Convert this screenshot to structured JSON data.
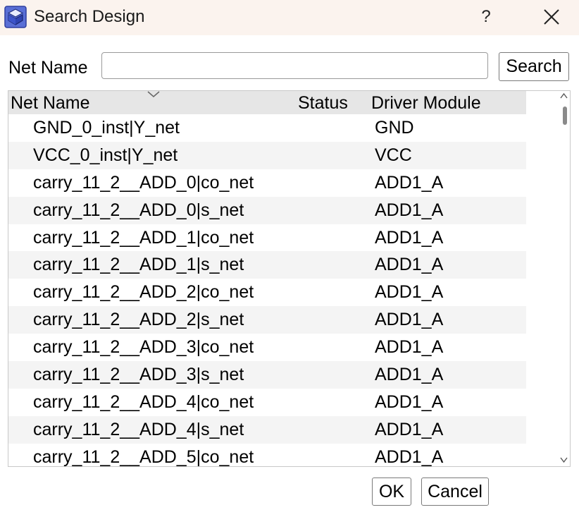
{
  "window": {
    "title": "Search Design",
    "help_label": "?",
    "icons": {
      "app": "app-logo-icon",
      "close": "close-icon"
    }
  },
  "search": {
    "label": "Net Name",
    "value": "",
    "placeholder": "",
    "button_label": "Search"
  },
  "table": {
    "columns": [
      "Net Name",
      "Status",
      "Driver Module"
    ],
    "sort_icon": "chevron-down-icon",
    "rows": [
      {
        "net_name": "GND_0_inst|Y_net",
        "status": "",
        "driver": "GND"
      },
      {
        "net_name": "VCC_0_inst|Y_net",
        "status": "",
        "driver": "VCC"
      },
      {
        "net_name": "carry_11_2__ADD_0|co_net",
        "status": "",
        "driver": "ADD1_A"
      },
      {
        "net_name": "carry_11_2__ADD_0|s_net",
        "status": "",
        "driver": "ADD1_A"
      },
      {
        "net_name": "carry_11_2__ADD_1|co_net",
        "status": "",
        "driver": "ADD1_A"
      },
      {
        "net_name": "carry_11_2__ADD_1|s_net",
        "status": "",
        "driver": "ADD1_A"
      },
      {
        "net_name": "carry_11_2__ADD_2|co_net",
        "status": "",
        "driver": "ADD1_A"
      },
      {
        "net_name": "carry_11_2__ADD_2|s_net",
        "status": "",
        "driver": "ADD1_A"
      },
      {
        "net_name": "carry_11_2__ADD_3|co_net",
        "status": "",
        "driver": "ADD1_A"
      },
      {
        "net_name": "carry_11_2__ADD_3|s_net",
        "status": "",
        "driver": "ADD1_A"
      },
      {
        "net_name": "carry_11_2__ADD_4|co_net",
        "status": "",
        "driver": "ADD1_A"
      },
      {
        "net_name": "carry_11_2__ADD_4|s_net",
        "status": "",
        "driver": "ADD1_A"
      },
      {
        "net_name": "carry_11_2__ADD_5|co_net",
        "status": "",
        "driver": "ADD1_A"
      }
    ]
  },
  "footer": {
    "ok_label": "OK",
    "cancel_label": "Cancel"
  },
  "colors": {
    "titlebar_bg": "#fbf3ee",
    "header_bg": "#e6e6e6",
    "alt_row_bg": "#f4f4f4",
    "icon_accent": "#3b4fb8"
  }
}
